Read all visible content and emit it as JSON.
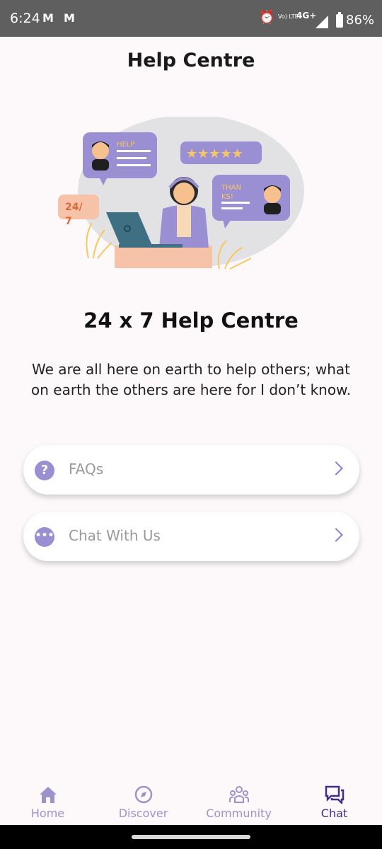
{
  "status_bar": {
    "time": "6:24",
    "mail_icons": [
      "M",
      "M"
    ],
    "volte": "Vo) LTE",
    "network": "4G+",
    "battery": "86%"
  },
  "page": {
    "title": "Help Centre",
    "heading": "24 x 7 Help Centre",
    "quote": "We are all here on earth to help others; what on earth the others are here for I don’t know."
  },
  "illustration": {
    "help_bubble_text": "HELP",
    "thanks_bubble_text_1": "THAN",
    "thanks_bubble_text_2": "KS!",
    "badge_text_1": "24/",
    "badge_text_2": "7",
    "stars": 5
  },
  "options": [
    {
      "label": "FAQs",
      "icon": "question-icon"
    },
    {
      "label": "Chat With Us",
      "icon": "chat-dots-icon"
    }
  ],
  "nav": [
    {
      "label": "Home",
      "icon": "home-icon",
      "active": false
    },
    {
      "label": "Discover",
      "icon": "compass-icon",
      "active": false
    },
    {
      "label": "Community",
      "icon": "community-icon",
      "active": false
    },
    {
      "label": "Chat",
      "icon": "chat-icon",
      "active": true
    }
  ],
  "colors": {
    "accent": "#9b8fd4",
    "active_nav": "#3f2f86",
    "status_bar": "#5f5f5f"
  }
}
